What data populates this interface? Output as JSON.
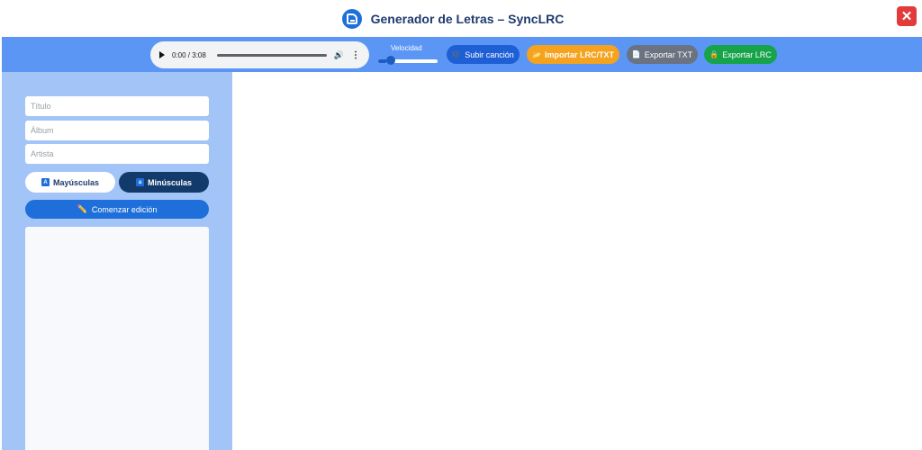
{
  "window": {
    "title": "Generador de Letras – SyncLRC",
    "logo_icon": "lyrics-doc-icon",
    "close_label": "✕"
  },
  "player": {
    "time": "0:00 / 3:08",
    "progress": 0
  },
  "speed": {
    "label": "Velocidad",
    "level": 0.15
  },
  "toolbar": {
    "upload_label": "Subir canción",
    "upload_icon": "🎼",
    "import_label": "Importar LRC/TXT",
    "import_icon": "📂",
    "export_txt_label": "Exportar TXT",
    "export_txt_icon": "📄",
    "export_lrc_label": "Exportar LRC",
    "export_lrc_icon": "🔒"
  },
  "sidebar": {
    "title_placeholder": "Título",
    "album_placeholder": "Álbum",
    "artist_placeholder": "Artista",
    "upper_label": "Mayúsculas",
    "lower_label": "Minúsculas",
    "edit_label": "Comenzar edición",
    "edit_icon": "✏️"
  },
  "colors": {
    "toolbar": "#5b96f5",
    "sidebar": "#a3c4f7",
    "upload": "#1f5fd6",
    "import": "#f5a21f",
    "export_txt": "#6b7280",
    "export_lrc": "#16a34a",
    "close": "#e23b3b"
  }
}
